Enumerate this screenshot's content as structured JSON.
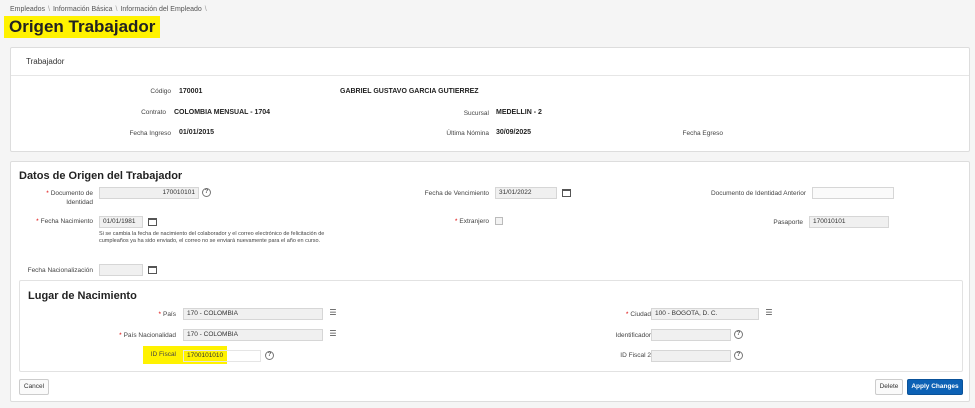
{
  "breadcrumb": [
    "Empleados",
    "Información Básica",
    "Información del Empleado"
  ],
  "page_title": "Origen Trabajador",
  "trabajador": {
    "heading": "Trabajador",
    "codigo_label": "Código",
    "codigo_value": "170001",
    "nombre": "GABRIEL GUSTAVO GARCIA GUTIERREZ",
    "contrato_label": "Contrato",
    "contrato_value": "COLOMBIA MENSUAL - 1704",
    "sucursal_label": "Sucursal",
    "sucursal_value": "MEDELLIN - 2",
    "fecha_ingreso_label": "Fecha Ingreso",
    "fecha_ingreso_value": "01/01/2015",
    "ultima_nomina_label": "Última Nómina",
    "ultima_nomina_value": "30/09/2025",
    "fecha_egreso_label": "Fecha Egreso"
  },
  "datos_origen": {
    "heading": "Datos de Origen del Trabajador",
    "documento_label_1": "Documento de",
    "documento_label_2": "Identidad",
    "documento_value": "170010101",
    "fecha_vencimiento_label": "Fecha de Vencimiento",
    "fecha_vencimiento_value": "31/01/2022",
    "doc_anterior_label": "Documento de Identidad Anterior",
    "doc_anterior_value": "",
    "fecha_nacimiento_label": "Fecha Nacimiento",
    "fecha_nacimiento_value": "01/01/1981",
    "extranjero_label": "Extranjero",
    "pasaporte_label": "Pasaporte",
    "pasaporte_value": "170010101",
    "nacimiento_note": "Si se cambia la fecha de nacimiento del colaborador y el correo electrónico de felicitación de cumpleaños ya ha sido enviado, el correo no se enviará nuevamente para el año en curso.",
    "fecha_nacionalizacion_label": "Fecha Nacionalización",
    "fecha_nacionalizacion_value": ""
  },
  "lugar_nacimiento": {
    "heading": "Lugar de Nacimiento",
    "pais_label": "País",
    "pais_value": "170 - COLOMBIA",
    "ciudad_label": "Ciudad",
    "ciudad_value": "100 - BOGOTA, D. C.",
    "pais_nacionalidad_label": "País Nacionalidad",
    "pais_nacionalidad_value": "170 - COLOMBIA",
    "identificador_label": "Identificador",
    "identificador_value": "",
    "id_fiscal_label": "ID Fiscal",
    "id_fiscal_value": "1700101010",
    "id_fiscal2_label": "ID Fiscal 2",
    "id_fiscal2_value": ""
  },
  "buttons": {
    "cancel": "Cancel",
    "delete": "Delete",
    "apply": "Apply Changes"
  },
  "colors": {
    "highlight": "#fff200",
    "primary": "#0c61b5",
    "required": "#dd0000"
  },
  "icons": [
    "help-icon",
    "calendar-icon",
    "list-icon"
  ]
}
